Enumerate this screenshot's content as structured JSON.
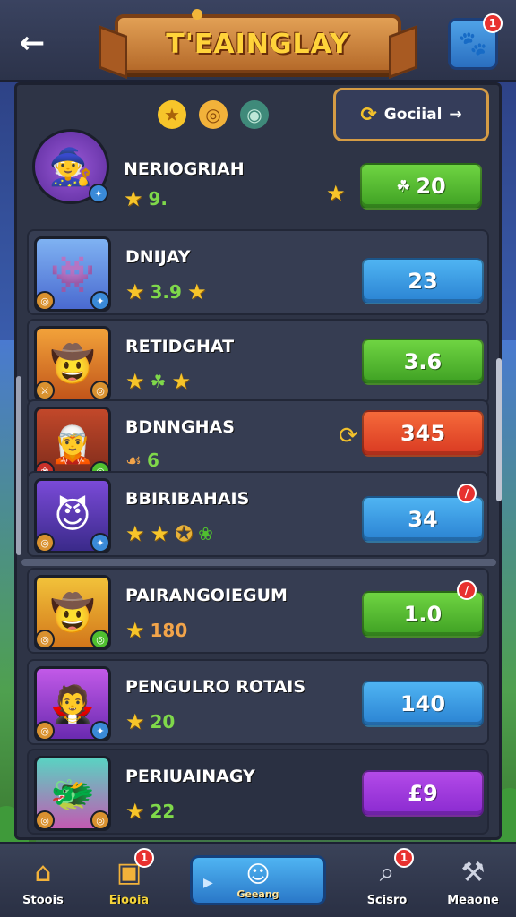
{
  "header": {
    "title": "T'EAINGLAY",
    "profile_badge": "1"
  },
  "top_bar": {
    "special_label": "Gociial"
  },
  "rows": [
    {
      "name": "NERIOGRIAH",
      "stat": "9.",
      "value": "20",
      "btn_color": "green"
    },
    {
      "name": "DNIJAY",
      "stat": "3.9",
      "value": "23",
      "btn_color": "blue"
    },
    {
      "name": "RETIDGHAT",
      "stat": "",
      "value": "3.6",
      "btn_color": "green"
    },
    {
      "name": "BDNNGHAS",
      "stat": "6",
      "value": "345",
      "btn_color": "red"
    },
    {
      "name": "BBIRIBAHAIS",
      "stat": "",
      "value": "34",
      "btn_color": "blue"
    },
    {
      "name": "PAIRANGOIEGUM",
      "stat": "180",
      "value": "1.0",
      "btn_color": "green"
    },
    {
      "name": "PENGULRO ROTAIS",
      "stat": "20",
      "value": "140",
      "btn_color": "blue"
    },
    {
      "name": "PERIUAINAGY",
      "stat": "22",
      "value": "£9",
      "btn_color": "purple"
    }
  ],
  "nav": {
    "items": [
      {
        "label": "Stoois",
        "icon": "house-icon"
      },
      {
        "label": "Eiooia",
        "icon": "card-icon",
        "badge": "1"
      },
      {
        "label": "Geeang",
        "icon": "hero-icon"
      },
      {
        "label": "Scisro",
        "icon": "search-icon",
        "badge": "1"
      },
      {
        "label": "Meaone",
        "icon": "wrench-icon"
      }
    ]
  },
  "colors": {
    "green": "#4fbf2f",
    "blue": "#3a9ae2",
    "red": "#e8502e",
    "purple": "#9f38dc",
    "gold": "#f7c52a"
  }
}
